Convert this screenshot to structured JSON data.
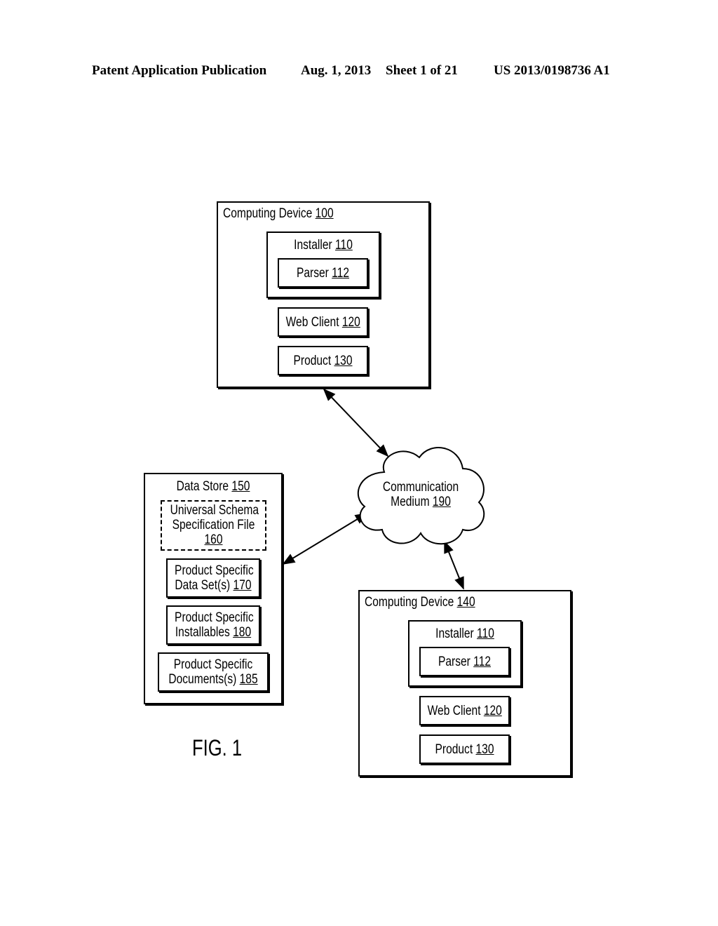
{
  "header": {
    "publication": "Patent Application Publication",
    "date": "Aug. 1, 2013",
    "sheet": "Sheet 1 of 21",
    "number": "US 2013/0198736 A1"
  },
  "device_100": {
    "title": "Computing Device ",
    "ref": "100",
    "installer": {
      "title": "Installer ",
      "ref": "110"
    },
    "parser": {
      "title": "Parser ",
      "ref": "112"
    },
    "web_client": {
      "title": "Web Client ",
      "ref": "120"
    },
    "product": {
      "title": "Product ",
      "ref": "130"
    }
  },
  "device_140": {
    "title": "Computing Device ",
    "ref": "140",
    "installer": {
      "title": "Installer ",
      "ref": "110"
    },
    "parser": {
      "title": "Parser ",
      "ref": "112"
    },
    "web_client": {
      "title": "Web Client ",
      "ref": "120"
    },
    "product": {
      "title": "Product ",
      "ref": "130"
    }
  },
  "data_store": {
    "title": "Data Store ",
    "ref": "150",
    "schema": {
      "line1": "Universal Schema",
      "line2": "Specification File",
      "ref": "160"
    },
    "datasets": {
      "line1": "Product Specific",
      "line2": "Data Set(s) ",
      "ref": "170"
    },
    "installables": {
      "line1": "Product Specific",
      "line2": "Installables ",
      "ref": "180"
    },
    "documents": {
      "line1": "Product Specific",
      "line2": "Documents(s) ",
      "ref": "185"
    }
  },
  "cloud": {
    "line1": "Communication",
    "line2": "Medium ",
    "ref": "190"
  },
  "figure_label": "FIG. 1"
}
